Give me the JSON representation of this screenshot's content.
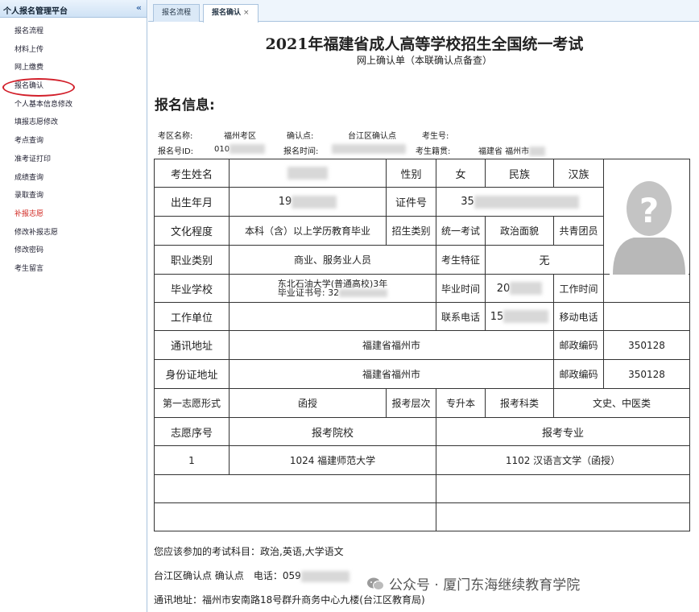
{
  "sidebar": {
    "title": "个人报名管理平台",
    "collapse_icon": "«",
    "items": [
      {
        "label": "报名流程"
      },
      {
        "label": "材料上传"
      },
      {
        "label": "网上缴费"
      },
      {
        "label": "报名确认"
      },
      {
        "label": "个人基本信息修改"
      },
      {
        "label": "填报志愿修改"
      },
      {
        "label": "考点查询"
      },
      {
        "label": "准考证打印"
      },
      {
        "label": "成绩查询"
      },
      {
        "label": "录取查询"
      },
      {
        "label": "补报志愿"
      },
      {
        "label": "修改补报志愿"
      },
      {
        "label": "修改密码"
      },
      {
        "label": "考生留言"
      }
    ]
  },
  "tabs": [
    {
      "label": "报名流程"
    },
    {
      "label": "报名确认",
      "close": "×"
    }
  ],
  "doc": {
    "title": "2021年福建省成人高等学校招生全国统一考试",
    "subtitle": "网上确认单（本联确认点备查）",
    "section_title": "报名信息:"
  },
  "info": {
    "exam_area_label": "考区名称:",
    "exam_area": "福州考区",
    "confirm_point_label": "确认点:",
    "confirm_point": "台江区确认点",
    "candidate_no_label": "考生号:",
    "reg_id_label": "报名号ID:",
    "reg_id": "010",
    "reg_time_label": "报名时间:",
    "origin_label": "考生籍贯:",
    "origin": "福建省 福州市"
  },
  "table": {
    "name_label": "考生姓名",
    "gender_label": "性别",
    "gender": "女",
    "ethnicity_label": "民族",
    "ethnicity": "汉族",
    "birth_label": "出生年月",
    "birth": "19",
    "id_label": "证件号",
    "id": "35",
    "education_label": "文化程度",
    "education": "本科（含）以上学历教育毕业",
    "category_label": "招生类别",
    "category": "统一考试",
    "politics_label": "政治面貌",
    "politics": "共青团员",
    "occupation_label": "职业类别",
    "occupation": "商业、服务业人员",
    "feature_label": "考生特征",
    "feature": "无",
    "school_label": "毕业学校",
    "school_line1": "东北石油大学(普通高校)3年",
    "school_line2": "毕业证书号: 32",
    "grad_time_label": "毕业时间",
    "grad_time": "20",
    "work_time_label": "工作时间",
    "work_unit_label": "工作单位",
    "phone_label": "联系电话",
    "phone": "15",
    "mobile_label": "移动电话",
    "address_label": "通讯地址",
    "address": "福建省福州市",
    "postcode_label": "邮政编码",
    "postcode": "350128",
    "id_address_label": "身份证地址",
    "id_address": "福建省福州市",
    "postcode2_label": "邮政编码",
    "postcode2": "350128",
    "first_choice_label": "第一志愿形式",
    "first_choice": "函授",
    "level_label": "报考层次",
    "level": "专升本",
    "subject_label": "报考科类",
    "subject": "文史、中医类",
    "order_label": "志愿序号",
    "college_label": "报考院校",
    "major_label": "报考专业",
    "rows": [
      {
        "order": "1",
        "college": "1024 福建师范大学",
        "major": "1102 汉语言文学（函授）"
      }
    ]
  },
  "footer": {
    "subjects": "您应该参加的考试科目：政治,英语,大学语文",
    "contact": "台江区确认点 确认点　电话：059",
    "address": "通讯地址：福州市安南路18号群升商务中心九楼(台江区教育局)"
  },
  "watermark": "公众号 · 厦门东海继续教育学院",
  "colors": {
    "accent": "#a9c3de",
    "alert": "#d21f2a"
  }
}
